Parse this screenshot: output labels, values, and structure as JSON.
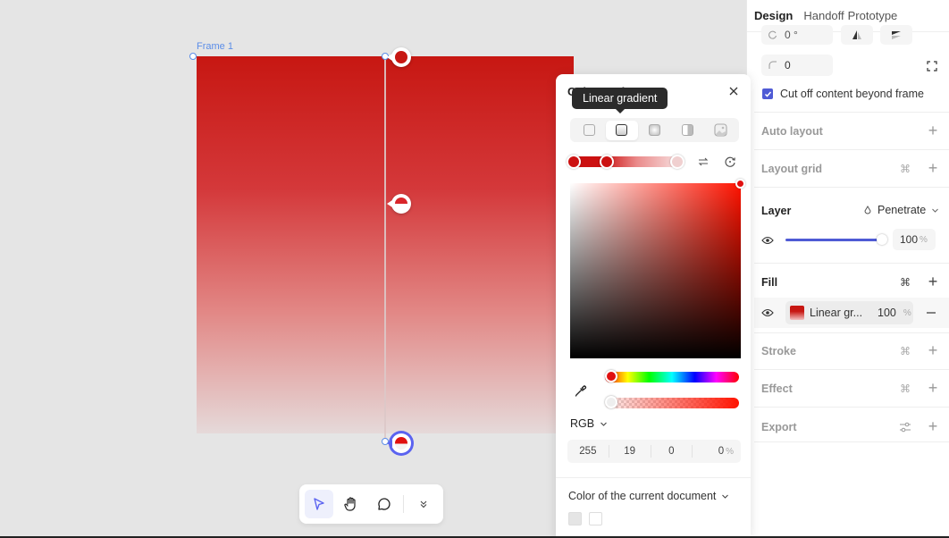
{
  "canvas": {
    "frame_label": "Frame 1",
    "frame_fill": {
      "type": "linear-gradient",
      "stops": [
        "#c71712",
        "#d4383a",
        "rgba(230,200,200,0.4)"
      ]
    }
  },
  "toolbar": {
    "tools": [
      {
        "name": "move",
        "icon": "cursor-arrow-icon",
        "active": true
      },
      {
        "name": "hand",
        "icon": "hand-icon",
        "active": false
      },
      {
        "name": "comment",
        "icon": "comment-bubble-icon",
        "active": false
      },
      {
        "name": "more",
        "icon": "double-chevron-down-icon",
        "active": false
      }
    ]
  },
  "color_panel": {
    "title": "Color setting",
    "tooltip": "Linear gradient",
    "fill_types": [
      {
        "name": "solid",
        "active": false
      },
      {
        "name": "linear-gradient",
        "active": true
      },
      {
        "name": "radial-gradient",
        "active": false
      },
      {
        "name": "angular-gradient",
        "active": false
      },
      {
        "name": "image",
        "active": false
      }
    ],
    "mode": "RGB",
    "rgba": {
      "r": "255",
      "g": "19",
      "b": "0",
      "a": "0",
      "a_unit": "%"
    },
    "hue_color": "#ff1300",
    "document_colors_label": "Color of the current document",
    "document_swatches": [
      "#e5e5e5",
      "#ffffff"
    ]
  },
  "right_panel": {
    "tabs": [
      {
        "label": "Design",
        "active": true
      },
      {
        "label": "Handoff"
      },
      {
        "label": "Prototype"
      }
    ],
    "rotation": "0 °",
    "corner_radius": "0",
    "clip_content": {
      "label": "Cut off content beyond frame",
      "checked": true
    },
    "sections": {
      "auto_layout": "Auto layout",
      "layout_grid": "Layout grid",
      "layer": "Layer",
      "fill": "Fill",
      "stroke": "Stroke",
      "effect": "Effect",
      "export": "Export"
    },
    "layer": {
      "blend_mode": "Penetrate",
      "opacity": "100",
      "opacity_unit": "%",
      "opacity_fraction": 1.0
    },
    "fill_item": {
      "label": "Linear gr...",
      "opacity": "100",
      "unit": "%"
    }
  },
  "colors": {
    "accent": "#4f5bd5",
    "selection": "#5b8de8",
    "active_stop_ring": "#5b63f0"
  }
}
